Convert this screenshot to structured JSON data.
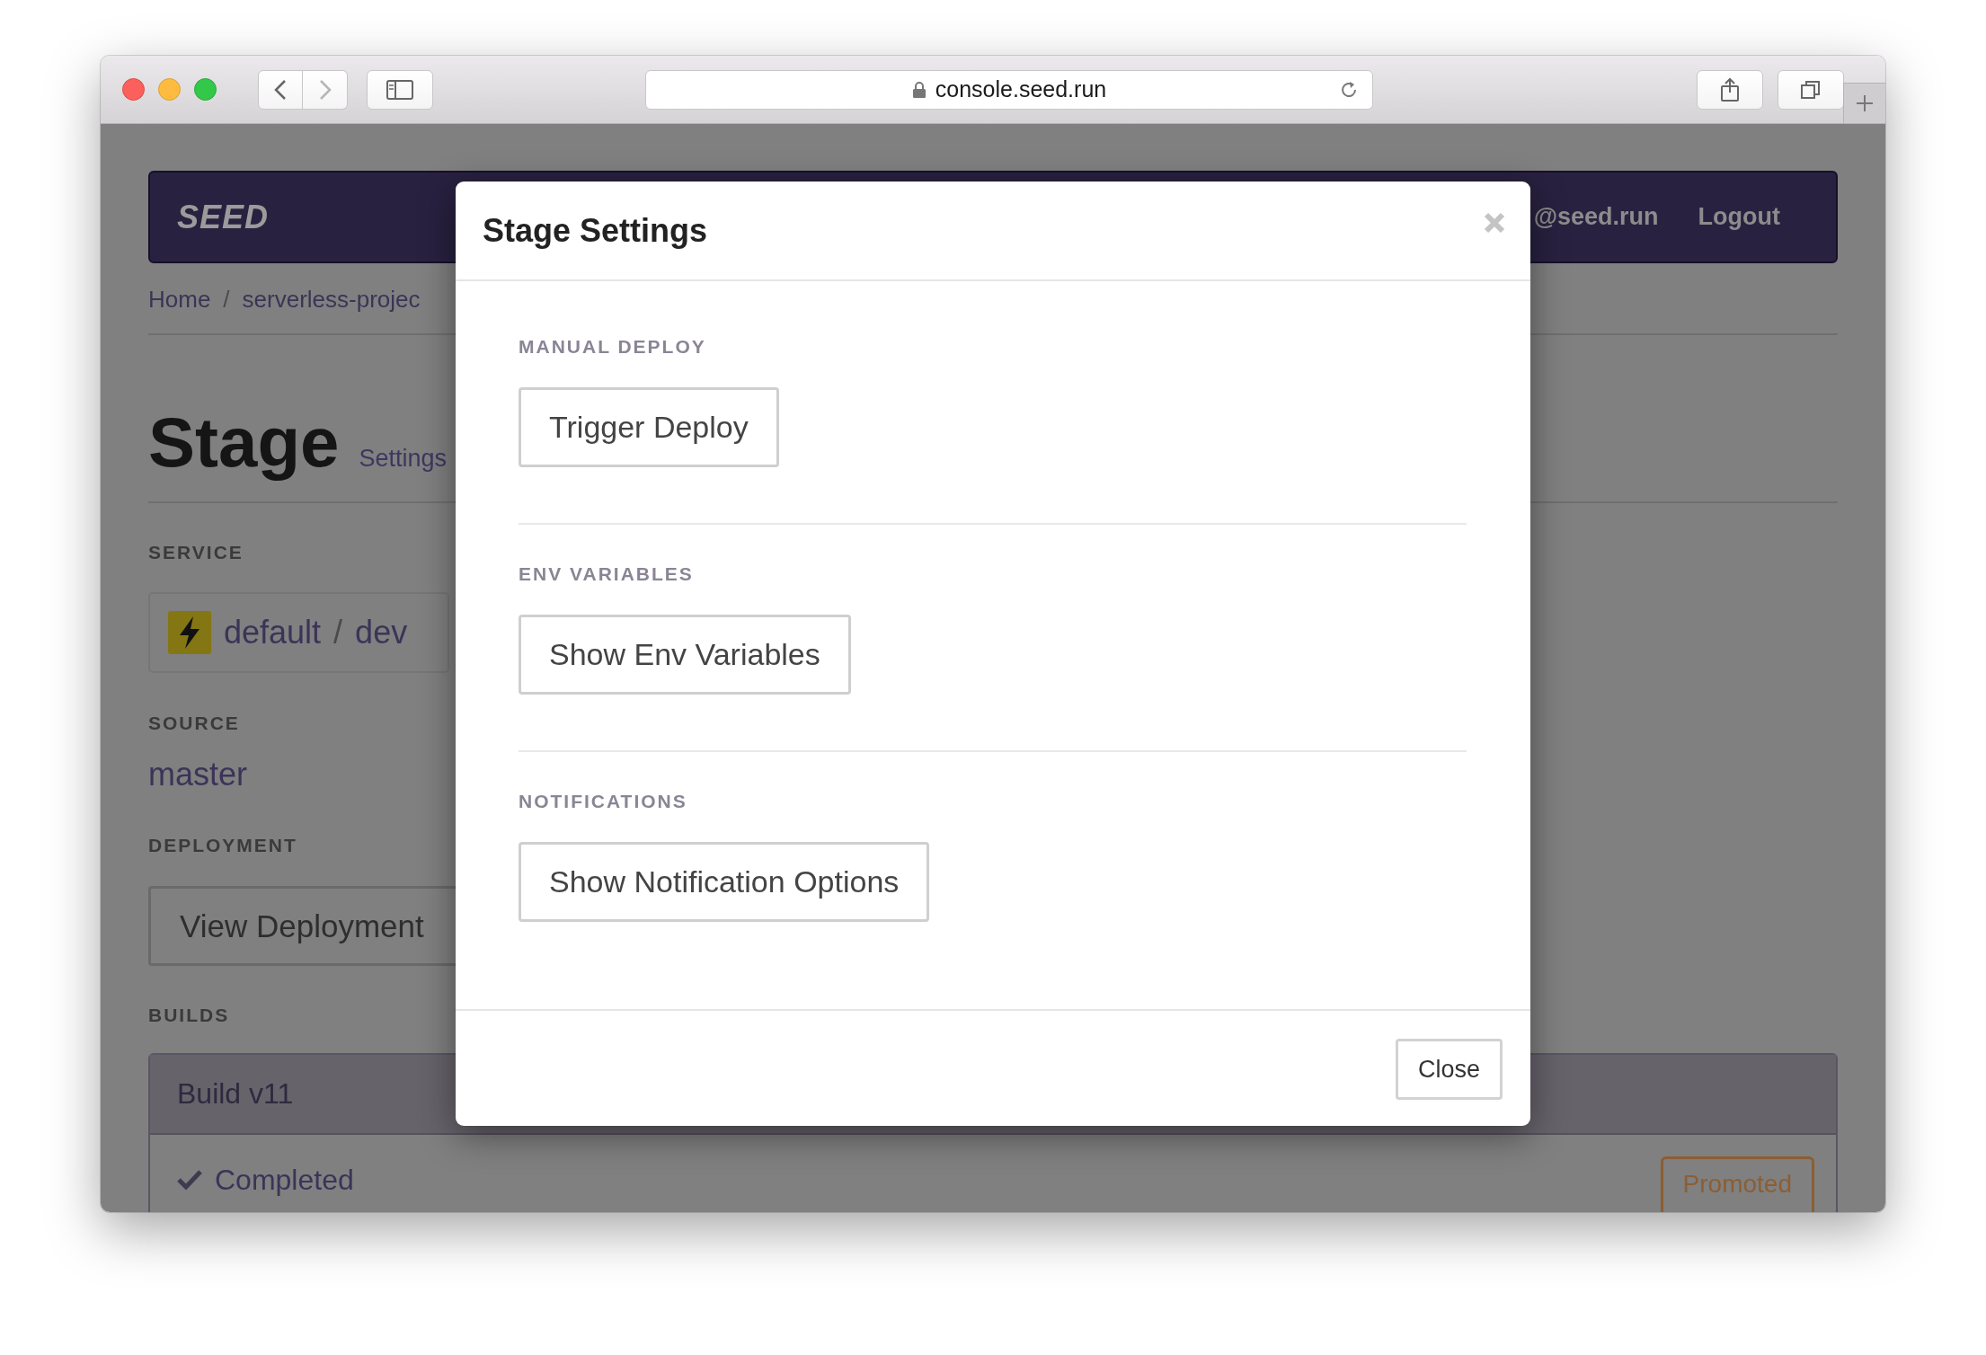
{
  "browser": {
    "url": "console.seed.run"
  },
  "navbar": {
    "logo": "SEED",
    "user": "@seed.run",
    "logout": "Logout"
  },
  "breadcrumb": {
    "items": [
      "Home",
      "serverless-projec"
    ],
    "separator": "/"
  },
  "heading": {
    "title": "Stage",
    "subtitle": "Settings"
  },
  "service": {
    "label": "SERVICE",
    "name": "default",
    "separator": "/",
    "stage": "dev"
  },
  "source": {
    "label": "SOURCE",
    "value": "master"
  },
  "deployment": {
    "label": "DEPLOYMENT",
    "button": "View Deployment"
  },
  "builds": {
    "label": "BUILDS",
    "items": [
      {
        "title": "Build v11",
        "status": "Completed",
        "badge": "Promoted"
      }
    ]
  },
  "modal": {
    "title": "Stage Settings",
    "sections": [
      {
        "label": "MANUAL DEPLOY",
        "button": "Trigger Deploy"
      },
      {
        "label": "ENV VARIABLES",
        "button": "Show Env Variables"
      },
      {
        "label": "NOTIFICATIONS",
        "button": "Show Notification Options"
      }
    ],
    "footer_button": "Close"
  }
}
